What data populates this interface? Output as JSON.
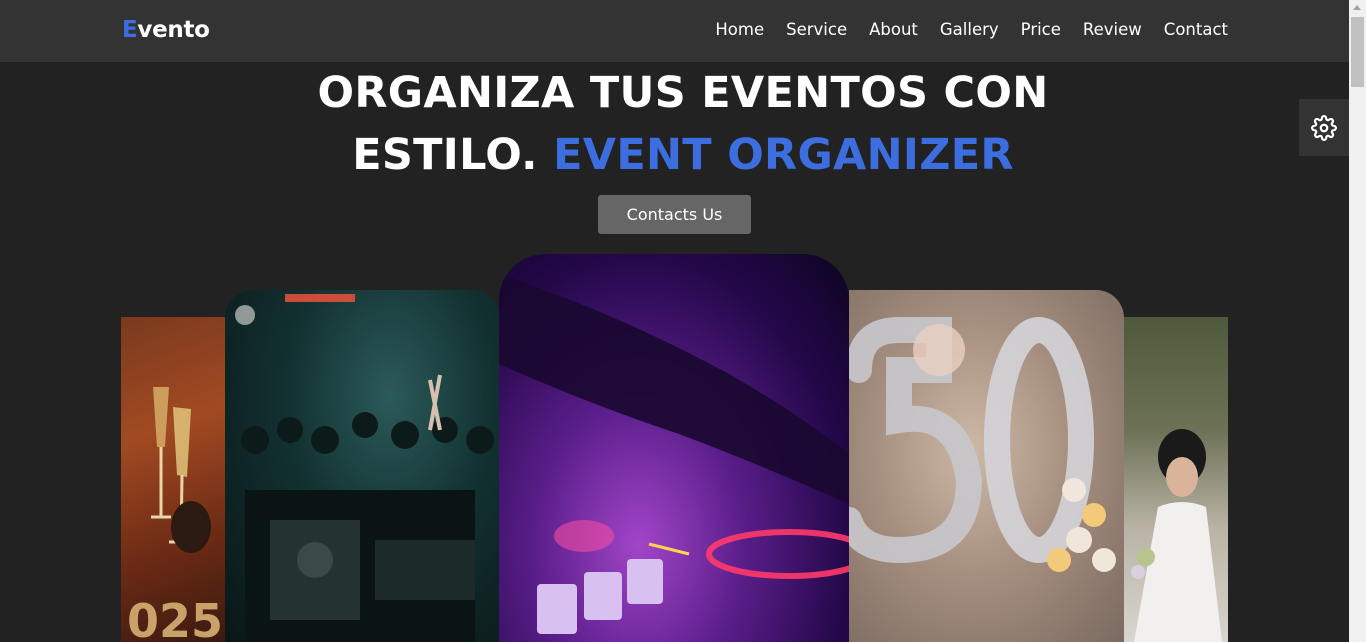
{
  "logo": {
    "first_letter": "E",
    "rest": "vento"
  },
  "nav": {
    "items": [
      "Home",
      "Service",
      "About",
      "Gallery",
      "Price",
      "Review",
      "Contact"
    ]
  },
  "hero": {
    "title_line1": "ORGANIZA TUS EVENTOS CON",
    "title_line2_white": "ESTILO.",
    "title_line2_accent": "EVENT ORGANIZER",
    "cta_label": "Contacts Us"
  },
  "colors": {
    "accent": "#3c6ee0",
    "background": "#222222",
    "header": "#333333",
    "button": "#666666"
  },
  "icons": {
    "settings": "gear-icon"
  }
}
